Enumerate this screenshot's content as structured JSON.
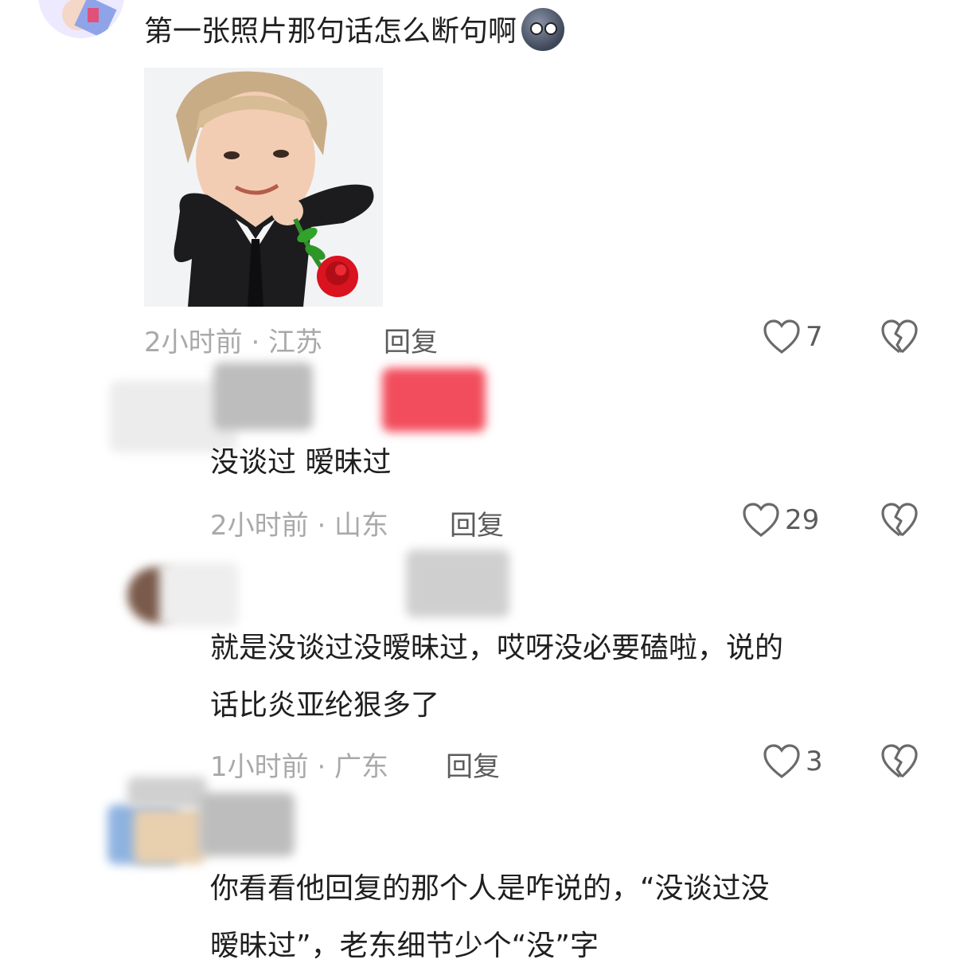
{
  "comments": [
    {
      "text": "第一张照片那句话怎么断句啊",
      "emoji": "new-moon-face",
      "time": "2小时前 · 江苏",
      "reply_label": "回复",
      "likes": "7"
    },
    {
      "text": "没谈过  暧昧过",
      "time": "2小时前 · 山东",
      "reply_label": "回复",
      "likes": "29"
    },
    {
      "text_line1": "就是没谈过没暧昧过，哎呀没必要磕啦，说的",
      "text_line2": "话比炎亚纶狠多了",
      "time": "1小时前 · 广东",
      "reply_label": "回复",
      "likes": "3"
    },
    {
      "text_line1": "你看看他回复的那个人是咋说的，“没谈过没",
      "text_line2": "暧昧过”，老东细节少个“没”字"
    }
  ],
  "colors": {
    "meta": "#a9a9a9",
    "reply": "#5b5b5b",
    "text": "#1f1f1f",
    "rose": "#d9131f"
  }
}
